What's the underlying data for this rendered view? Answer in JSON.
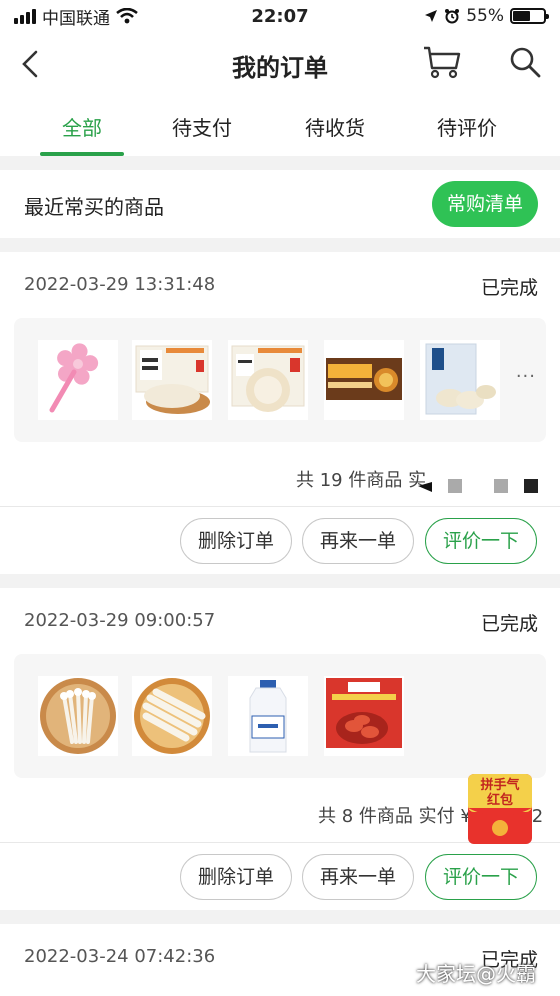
{
  "status_bar": {
    "carrier": "中国联通",
    "time": "22:07",
    "battery": "55%",
    "battery_level": 0.55
  },
  "nav": {
    "title": "我的订单"
  },
  "tabs": [
    {
      "label": "全部"
    },
    {
      "label": "待支付"
    },
    {
      "label": "待收货"
    },
    {
      "label": "待评价"
    }
  ],
  "recent": {
    "title": "最近常买的商品",
    "button": "常购清单"
  },
  "orders": [
    {
      "time": "2022-03-29 13:31:48",
      "status": "已完成",
      "summary": "共 19 件商品 实",
      "more": "···",
      "buttons": [
        "删除订单",
        "再来一单",
        "评价一下"
      ]
    },
    {
      "time": "2022-03-29 09:00:57",
      "status": "已完成",
      "summary": "共 8 件商品 实付 ¥",
      "summary_tail": "2",
      "buttons": [
        "删除订单",
        "再来一单",
        "评价一下"
      ]
    },
    {
      "time": "2022-03-24 07:42:36",
      "status": "已完成"
    }
  ],
  "floating": {
    "line1": "拼手气",
    "line2": "红包"
  },
  "watermark": "大家坛@火霸",
  "colors": {
    "accent": "#2aa14a",
    "button_green": "#2fc255",
    "redpack": "#e8322c"
  }
}
